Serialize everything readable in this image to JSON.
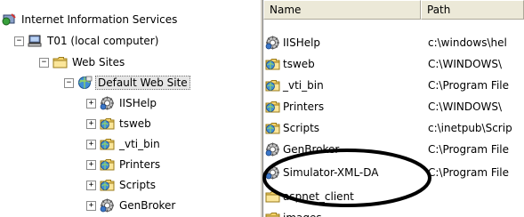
{
  "tree": {
    "root_label": "Internet Information Services",
    "computer_label": "T01 (local computer)",
    "websites_label": "Web Sites",
    "default_site_label": "Default Web Site",
    "children": [
      "IISHelp",
      "tsweb",
      "_vti_bin",
      "Printers",
      "Scripts",
      "GenBroker"
    ],
    "expander_plus": "+",
    "expander_minus": "−"
  },
  "list": {
    "col_name": "Name",
    "col_path": "Path",
    "rows": [
      {
        "name": "IISHelp",
        "path": "c:\\windows\\hel",
        "icon": "web-app-icon"
      },
      {
        "name": "tsweb",
        "path": "C:\\WINDOWS\\",
        "icon": "virtual-folder-icon"
      },
      {
        "name": "_vti_bin",
        "path": "C:\\Program File",
        "icon": "virtual-folder-icon"
      },
      {
        "name": "Printers",
        "path": "C:\\WINDOWS\\",
        "icon": "virtual-folder-icon"
      },
      {
        "name": "Scripts",
        "path": "c:\\inetpub\\Scrip",
        "icon": "virtual-folder-icon"
      },
      {
        "name": "GenBroker",
        "path": "C:\\Program File",
        "icon": "web-app-icon"
      },
      {
        "name": "Simulator-XML-DA",
        "path": "C:\\Program File",
        "icon": "web-app-icon"
      },
      {
        "name": "aspnet_client",
        "path": "",
        "icon": "folder-icon"
      },
      {
        "name": "images",
        "path": "",
        "icon": "folder-icon"
      }
    ]
  },
  "colors": {
    "folder": "#f5d36a",
    "virtual_folder": "#3f8fd8",
    "annotation": "#000000"
  }
}
